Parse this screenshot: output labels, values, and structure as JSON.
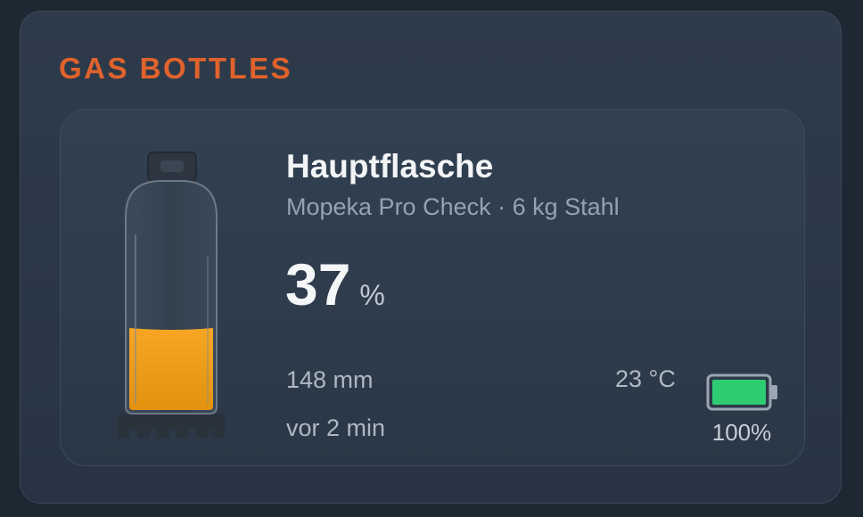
{
  "section": {
    "title": "GAS BOTTLES"
  },
  "bottle": {
    "name": "Hauptflasche",
    "subtitle": "Mopeka Pro Check · 6 kg Stahl",
    "level_value": "37",
    "level_unit": "%",
    "level_fraction": 0.37,
    "distance": "148 mm",
    "updated": "vor 2 min",
    "temperature": "23 °C",
    "battery_text": "100%",
    "battery_fraction": 1.0
  },
  "colors": {
    "accent": "#e0622c",
    "fill": "#f0a11e",
    "battery": "#2ecc71"
  },
  "icons": {
    "bottle": "gas-bottle-icon",
    "battery": "battery-full-icon"
  }
}
